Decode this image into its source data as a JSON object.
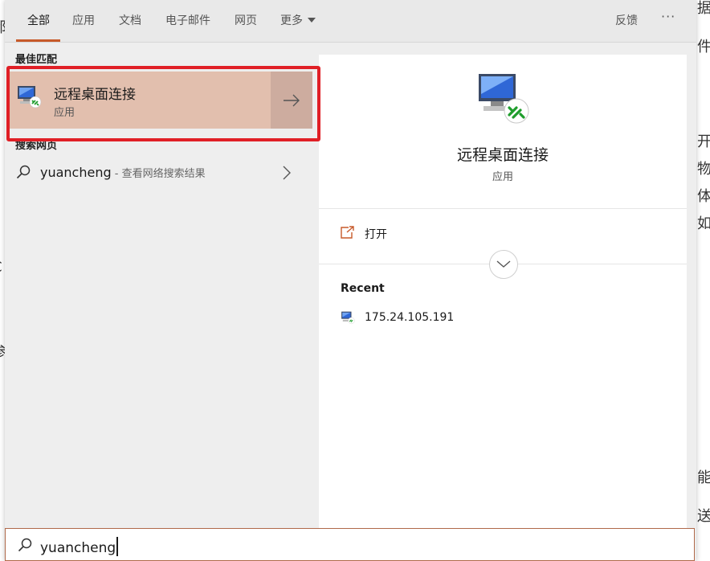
{
  "background_glyphs": {
    "right": [
      "据",
      "件",
      "开",
      "物",
      "体",
      "如",
      "能",
      "送"
    ],
    "left": [
      "都",
      "C",
      "参"
    ]
  },
  "tabs": [
    {
      "label": "全部",
      "active": true
    },
    {
      "label": "应用"
    },
    {
      "label": "文档"
    },
    {
      "label": "电子邮件"
    },
    {
      "label": "网页"
    },
    {
      "label": "更多"
    }
  ],
  "header_right": {
    "feedback_label": "反馈",
    "more_options_label": "···"
  },
  "best_match": {
    "heading": "最佳匹配",
    "title": "远程桌面连接",
    "subtitle": "应用",
    "icon": "remote-desktop-icon"
  },
  "web_search": {
    "heading": "搜索网页",
    "query": "yuancheng",
    "suffix": " - 查看网络搜索结果"
  },
  "detail": {
    "title": "远程桌面连接",
    "subtitle": "应用",
    "actions": [
      {
        "label": "打开",
        "icon": "open-icon"
      }
    ],
    "recent_heading": "Recent",
    "recent": [
      {
        "label": "175.24.105.191",
        "icon": "remote-desktop-icon"
      }
    ]
  },
  "search": {
    "value": "yuancheng",
    "icon": "search-icon"
  },
  "colors": {
    "accent": "#c75a2a",
    "highlight": "#e2bfae",
    "annotation": "#e01f26"
  }
}
